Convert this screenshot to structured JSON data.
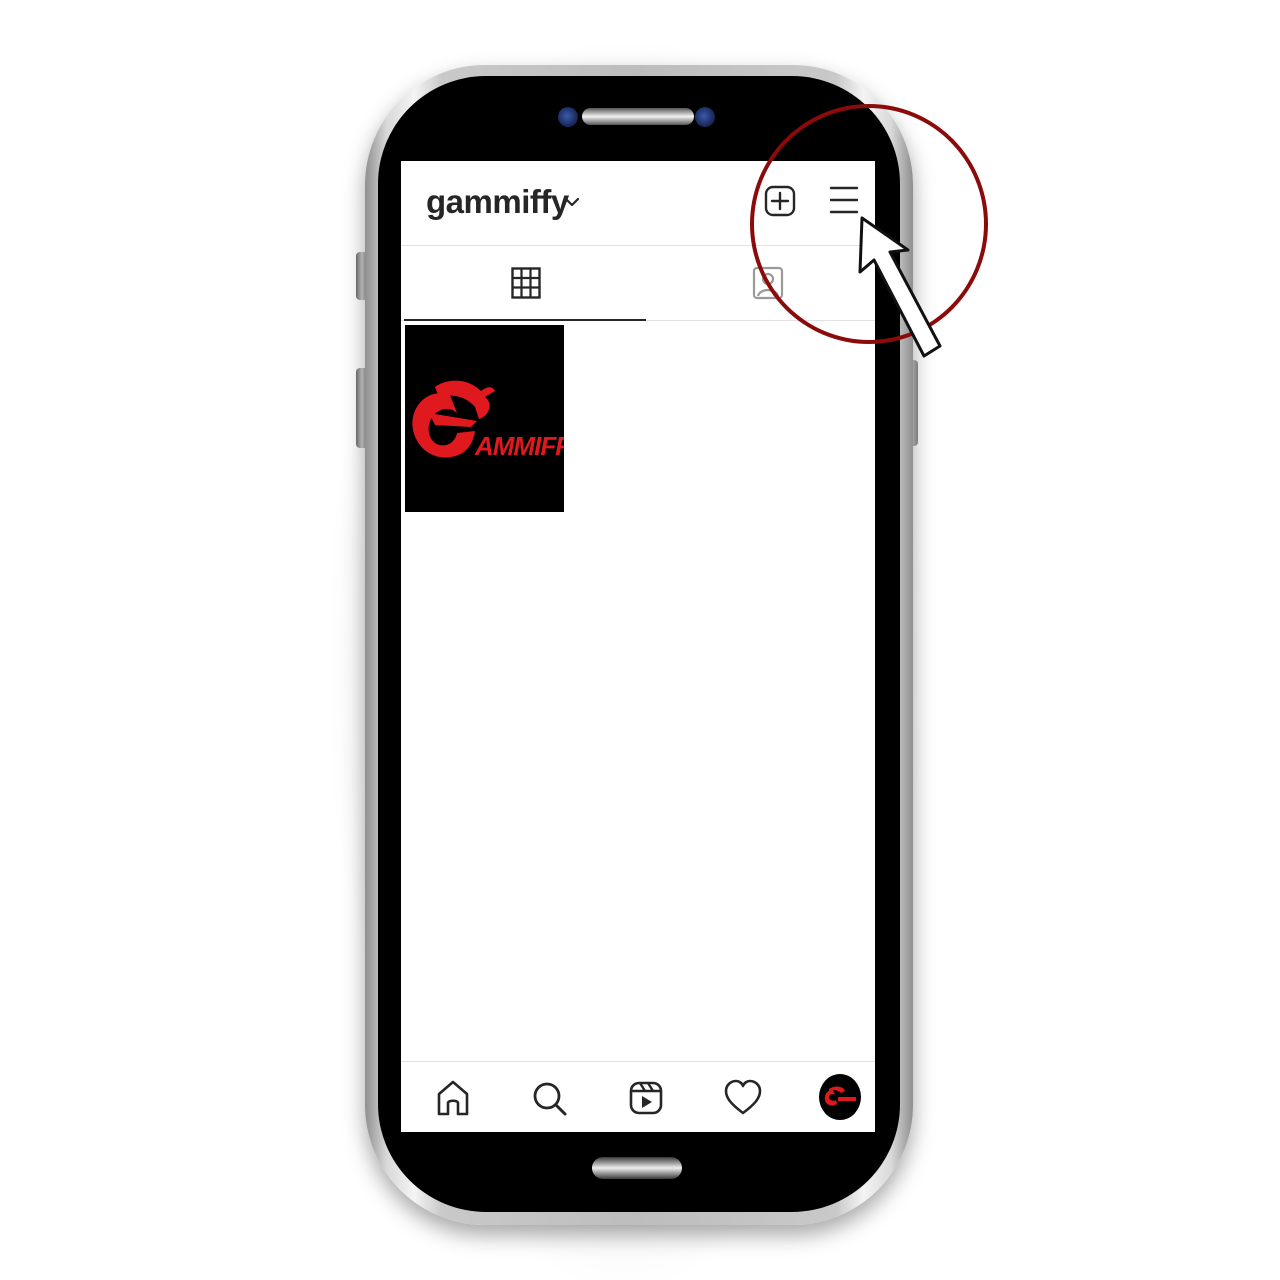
{
  "header": {
    "username": "gammiffy",
    "icons": [
      "chevron-down-icon",
      "new-post-icon",
      "hamburger-menu-icon"
    ]
  },
  "tabs": [
    {
      "name": "grid",
      "icon": "grid-icon",
      "selected": true
    },
    {
      "name": "tagged",
      "icon": "tagged-icon",
      "selected": false
    }
  ],
  "posts": [
    {
      "logo_text": "AMMIFFY",
      "logo_initial": "G",
      "bg_color": "#000000",
      "accent_color": "#e0191e"
    }
  ],
  "bottom_nav": [
    {
      "name": "home",
      "icon": "home-icon"
    },
    {
      "name": "search",
      "icon": "search-icon"
    },
    {
      "name": "reels",
      "icon": "reels-icon"
    },
    {
      "name": "activity",
      "icon": "heart-icon"
    },
    {
      "name": "profile",
      "icon": "avatar"
    }
  ],
  "annotation": {
    "circle_color": "#8b0b0b",
    "arrow": "pointer-arrow-icon"
  },
  "colors": {
    "text": "#262626",
    "divider": "#e2e2e2",
    "accent_red": "#e0191e"
  }
}
